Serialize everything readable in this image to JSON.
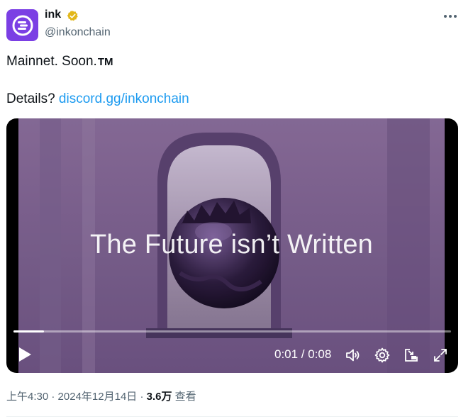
{
  "author": {
    "display_name": "ink",
    "handle": "@inkonchain",
    "avatar_color": "#7b3fe4",
    "verified_color": "#e2b719"
  },
  "tweet": {
    "line1": "Mainnet. Soon.",
    "line1_mark": "TM",
    "line2_prefix": "Details? ",
    "link_text": "discord.gg/inkonchain",
    "link_color": "#1d9bf0"
  },
  "video": {
    "overlay_text": "The Future isn’t Written",
    "time_display": "0:01 / 0:08",
    "progress_fraction": 0.07
  },
  "meta": {
    "time": "上午4:30",
    "sep1": " · ",
    "date": "2024年12月14日",
    "sep2": " · ",
    "views": "3.6万",
    "views_label": " 查看"
  },
  "icons": {
    "avatar": "ink-logo-icon",
    "verified": "verified-badge-icon",
    "more": "more-icon",
    "play": "play-icon",
    "volume": "volume-icon",
    "settings": "settings-icon",
    "dock": "dock-icon",
    "fullscreen": "fullscreen-icon"
  }
}
